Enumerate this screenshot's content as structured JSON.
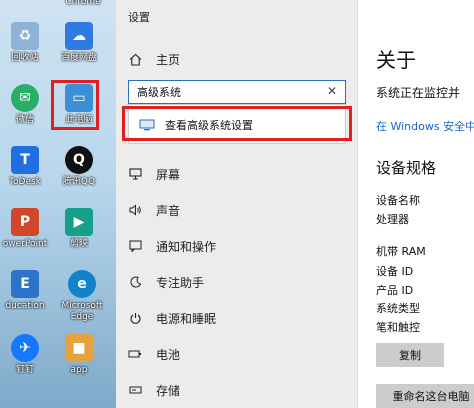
{
  "desktop": {
    "icons": [
      {
        "label": "Chrome",
        "icon": "chrome-icon",
        "color": "#d33"
      },
      {
        "label": "回收站",
        "icon": "recycle-bin-icon",
        "color": "#5b8fc7"
      },
      {
        "label": "百度网盘",
        "icon": "baidu-netdisk-icon",
        "color": "#2f7be3"
      },
      {
        "label": "微信",
        "icon": "wechat-icon",
        "color": "#2aae67"
      },
      {
        "label": "此电脑",
        "icon": "this-pc-icon",
        "color": "#3b8fd6"
      },
      {
        "label": "ToDesk",
        "icon": "todesk-icon",
        "color": "#1f6fe0"
      },
      {
        "label": "腾讯QQ",
        "icon": "qq-icon",
        "color": "#111"
      },
      {
        "label": "owerPoint",
        "icon": "powerpoint-icon",
        "color": "#d2472b"
      },
      {
        "label": "剪映",
        "icon": "video-editor-icon",
        "color": "#16a08a"
      },
      {
        "label": "ducation",
        "icon": "education-app-icon",
        "color": "#2d74c8"
      },
      {
        "label": "Microsoft Edge",
        "icon": "edge-icon",
        "color": "#1383c9"
      },
      {
        "label": "钉钉",
        "icon": "dingtalk-icon",
        "color": "#1677ff"
      },
      {
        "label": "app",
        "icon": "app-icon",
        "color": "#e6a23c"
      }
    ]
  },
  "settings": {
    "title": "设置",
    "home_label": "主页",
    "search_value": "高级系统",
    "suggestion": "查看高级系统设置",
    "nav": [
      {
        "label": "屏幕",
        "icon": "monitor-icon"
      },
      {
        "label": "声音",
        "icon": "speaker-icon"
      },
      {
        "label": "通知和操作",
        "icon": "notification-icon"
      },
      {
        "label": "专注助手",
        "icon": "focus-assist-icon"
      },
      {
        "label": "电源和睡眠",
        "icon": "power-icon"
      },
      {
        "label": "电池",
        "icon": "battery-icon"
      },
      {
        "label": "存储",
        "icon": "storage-icon"
      }
    ]
  },
  "about": {
    "title": "关于",
    "status": "系统正在监控并",
    "link": "在 Windows 安全中心",
    "specs_heading": "设备规格",
    "specs": [
      "设备名称",
      "处理器",
      "机带 RAM",
      "设备 ID",
      "产品 ID",
      "系统类型",
      "笔和触控"
    ],
    "copy_button": "复制",
    "rename_button": "重命名这台电脑"
  },
  "colors": {
    "highlight_red": "#e02020",
    "accent_blue": "#2b6cc4"
  }
}
